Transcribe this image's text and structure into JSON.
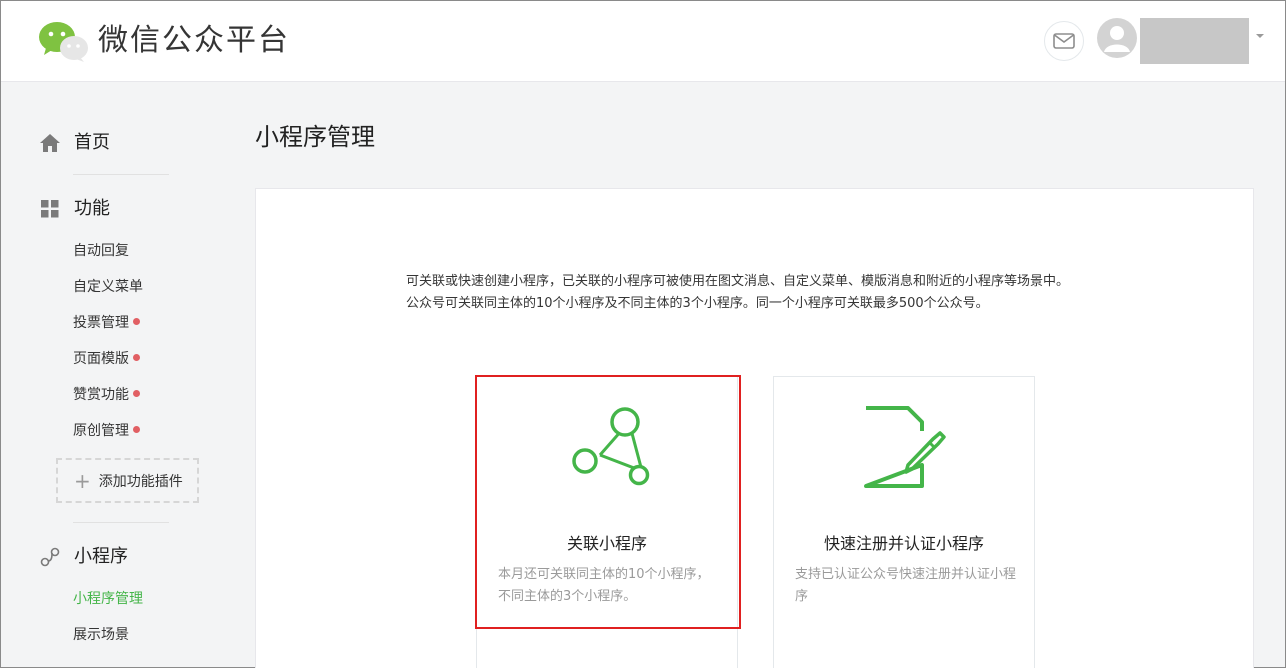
{
  "header": {
    "brand": "微信公众平台",
    "icons": {
      "logo": "wechat-logo",
      "mail": "mail-icon",
      "avatar": "user-avatar-icon",
      "menu": "caret-down-icon"
    }
  },
  "sidebar": {
    "home": {
      "label": "首页",
      "icon": "home-icon"
    },
    "features": {
      "label": "功能",
      "icon": "grid-icon",
      "items": [
        {
          "label": "自动回复",
          "dot": false
        },
        {
          "label": "自定义菜单",
          "dot": false
        },
        {
          "label": "投票管理",
          "dot": true
        },
        {
          "label": "页面模版",
          "dot": true
        },
        {
          "label": "赞赏功能",
          "dot": true
        },
        {
          "label": "原创管理",
          "dot": true
        }
      ],
      "add_plugin": "添加功能插件"
    },
    "miniprogram": {
      "label": "小程序",
      "icon": "link-icon",
      "items": [
        {
          "label": "小程序管理",
          "active": true
        },
        {
          "label": "展示场景",
          "active": false
        }
      ]
    }
  },
  "main": {
    "title": "小程序管理",
    "description_line1": "可关联或快速创建小程序，已关联的小程序可被使用在图文消息、自定义菜单、模版消息和附近的小程序等场景中。",
    "description_line2": "公众号可关联同主体的10个小程序及不同主体的3个小程序。同一个小程序可关联最多500个公众号。",
    "cards": [
      {
        "title": "关联小程序",
        "desc": "本月还可关联同主体的10个小程序，不同主体的3个小程序。",
        "icon": "link-nodes-icon"
      },
      {
        "title": "快速注册并认证小程序",
        "desc": "支持已认证公众号快速注册并认证小程序",
        "icon": "document-edit-icon"
      }
    ]
  },
  "colors": {
    "accent": "#44b549",
    "dot": "#e15f63",
    "highlight": "#e02020"
  }
}
